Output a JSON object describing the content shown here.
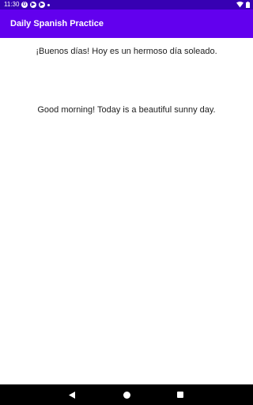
{
  "status_bar": {
    "time": "11:30",
    "notification_icons": [
      "google-icon",
      "play-icon",
      "play-icon",
      "dot-icon"
    ],
    "right_icons": [
      "wifi-icon",
      "battery-icon"
    ]
  },
  "app_bar": {
    "title": "Daily Spanish Practice",
    "color": "#6200ee",
    "status_color": "#3700b3"
  },
  "content": {
    "spanish_sentence": "¡Buenos días! Hoy es un hermoso día soleado.",
    "english_sentence": "Good morning! Today is a beautiful sunny day."
  },
  "nav_bar": {
    "buttons": [
      "back-icon",
      "home-icon",
      "recents-icon"
    ]
  }
}
